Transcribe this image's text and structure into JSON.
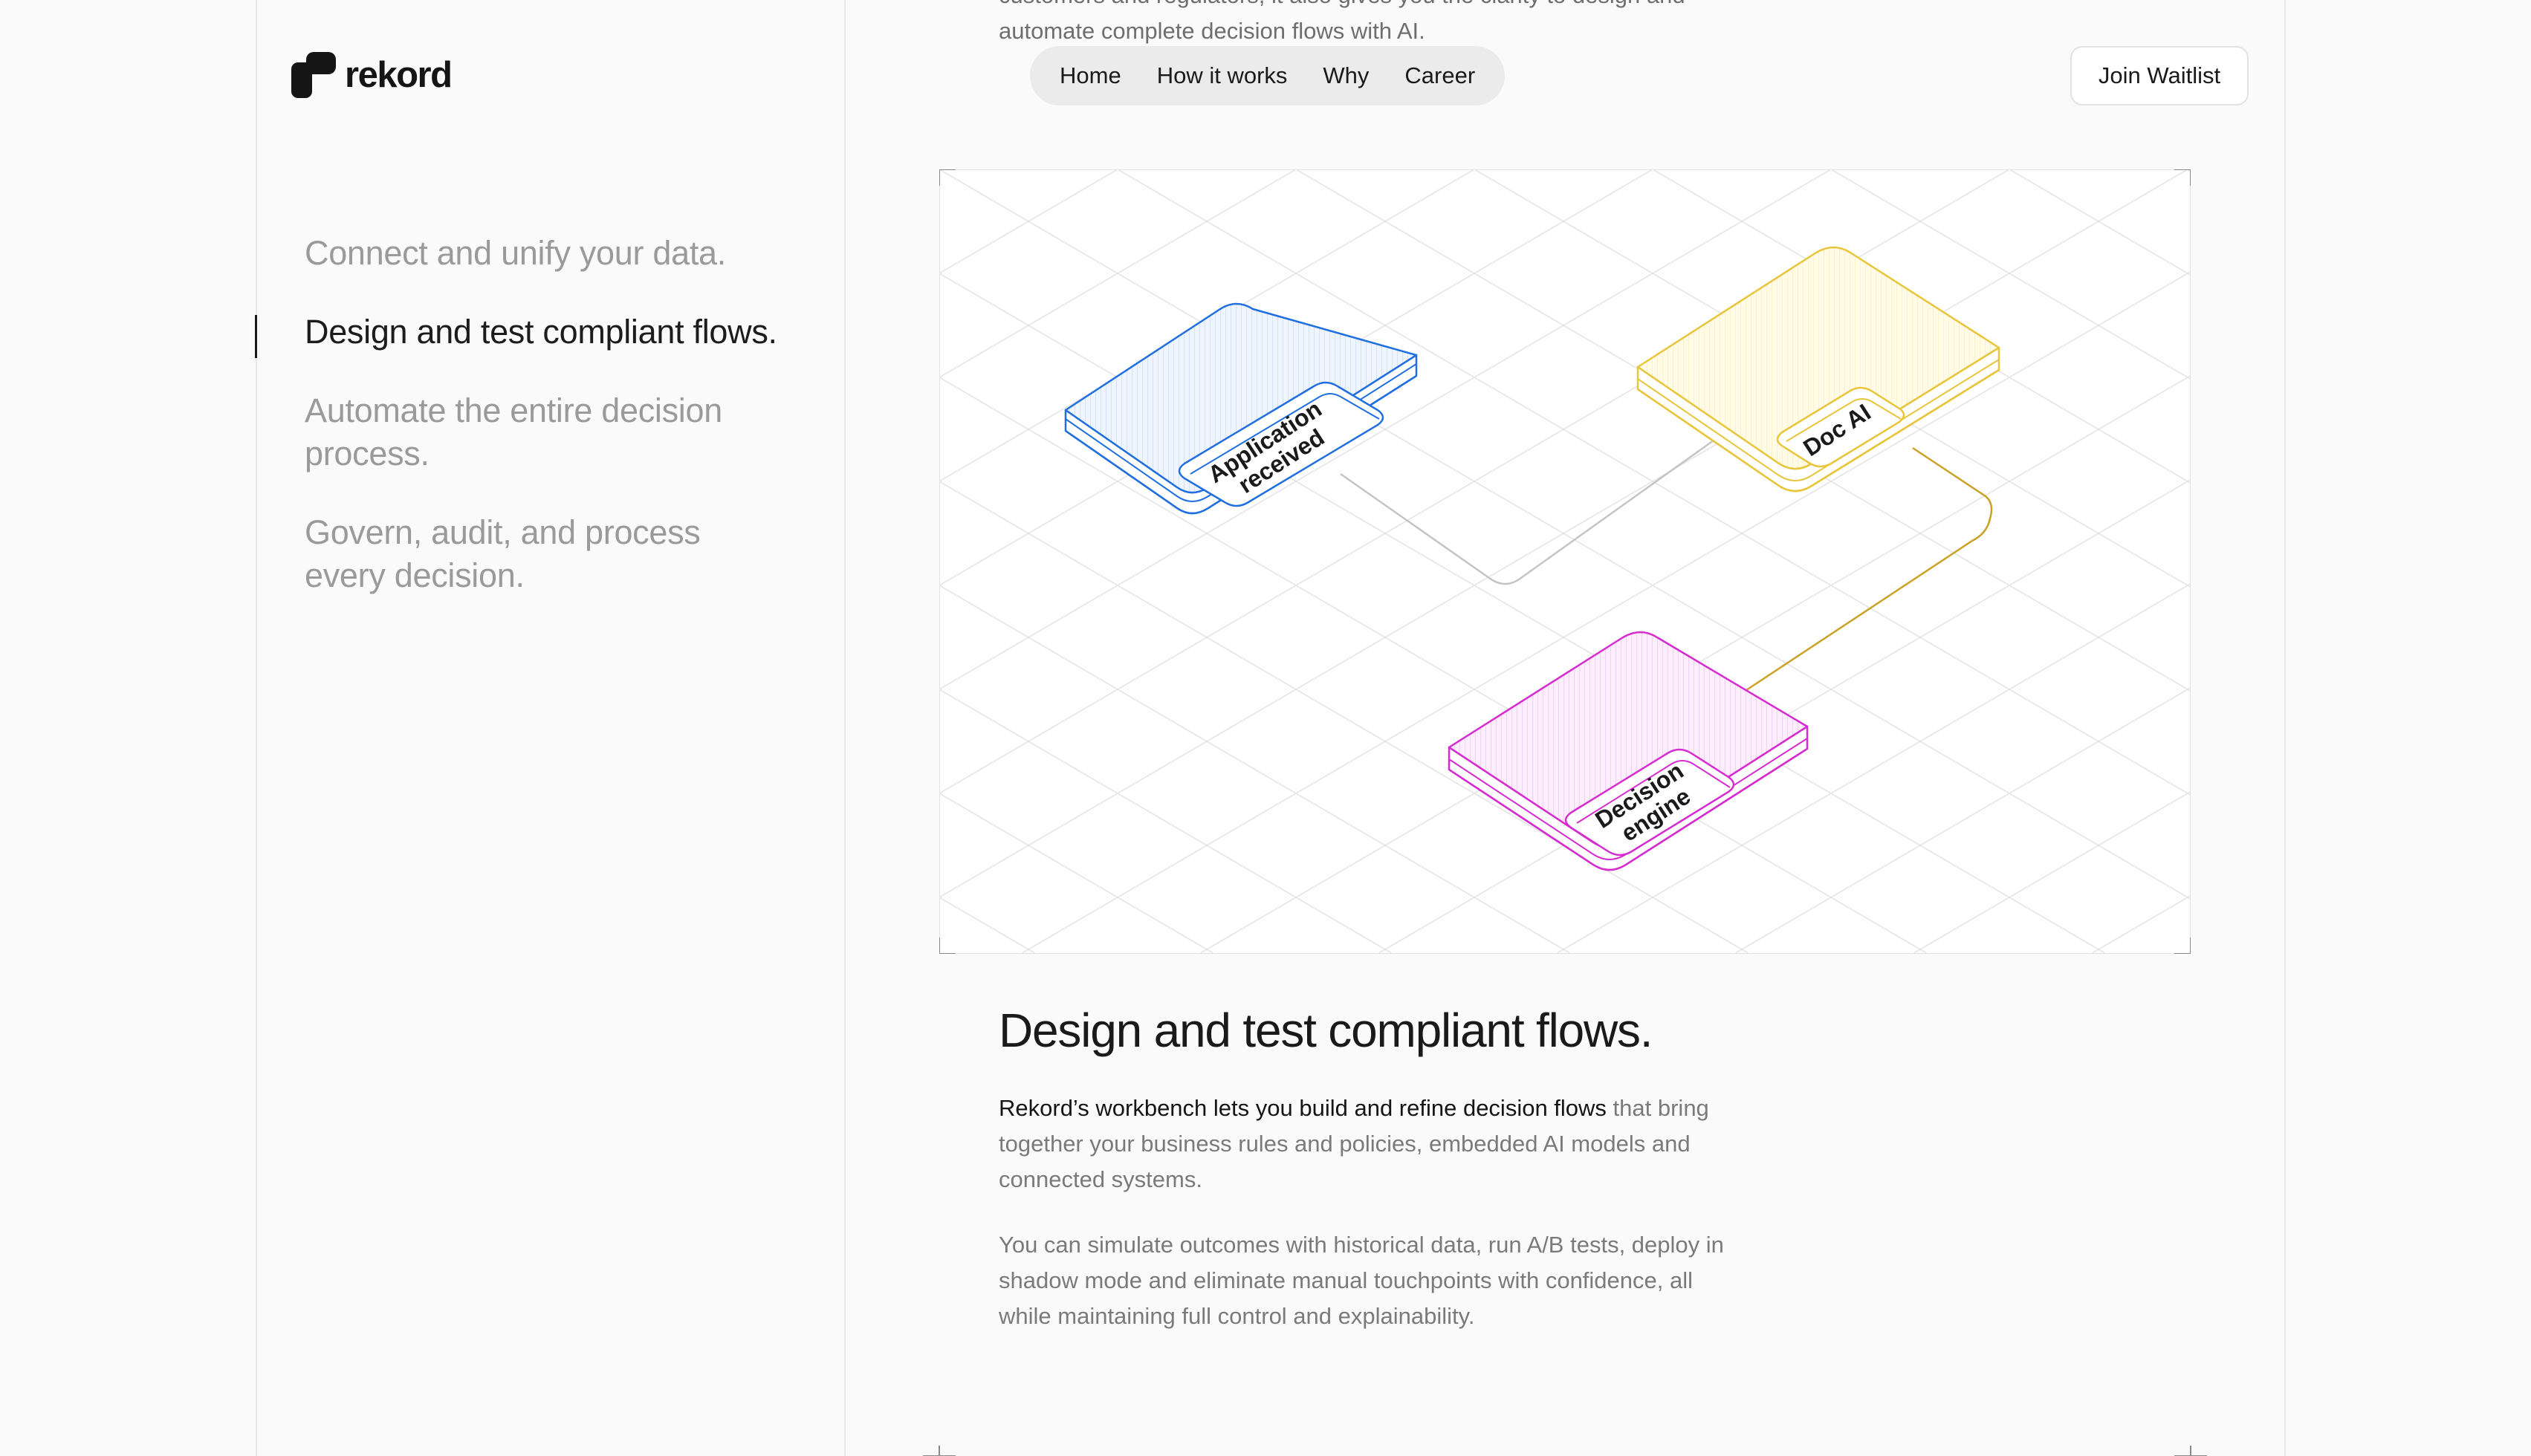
{
  "brand": {
    "name": "rekord"
  },
  "top_text": "customers and regulators, it also gives you the clarity to design and automate complete decision flows with AI.",
  "nav": {
    "items": [
      {
        "label": "Home"
      },
      {
        "label": "How it works"
      },
      {
        "label": "Why"
      },
      {
        "label": "Career"
      }
    ],
    "cta_label": "Join Waitlist"
  },
  "side_nav": {
    "items": [
      {
        "label": "Connect and unify your data.",
        "active": false
      },
      {
        "label": "Design and test compliant flows.",
        "active": true
      },
      {
        "label": "Automate the entire decision process.",
        "active": false
      },
      {
        "label": "Govern, audit, and process every decision.",
        "active": false
      }
    ]
  },
  "diagram": {
    "nodes": [
      {
        "id": "application",
        "label_line1": "Application",
        "label_line2": "received",
        "color": "#1f6fe0"
      },
      {
        "id": "docai",
        "label_line1": "Doc AI",
        "label_line2": "",
        "color": "#e8c53a"
      },
      {
        "id": "decision",
        "label_line1": "Decision",
        "label_line2": "engine",
        "color": "#d62bd0"
      }
    ],
    "connector_colors": {
      "app_to_doc": "#c4c4c4",
      "doc_to_decision": "#c9a227"
    }
  },
  "section": {
    "heading": "Design and test compliant flows.",
    "p1_strong": "Rekord’s workbench lets you build and refine decision flows",
    "p1_rest": " that bring together your business rules and policies, embedded AI models and connected systems.",
    "p2": "You can simulate outcomes with historical data, run A/B tests, deploy in shadow mode and eliminate manual touchpoints with confidence, all while maintaining full control and explainability."
  }
}
